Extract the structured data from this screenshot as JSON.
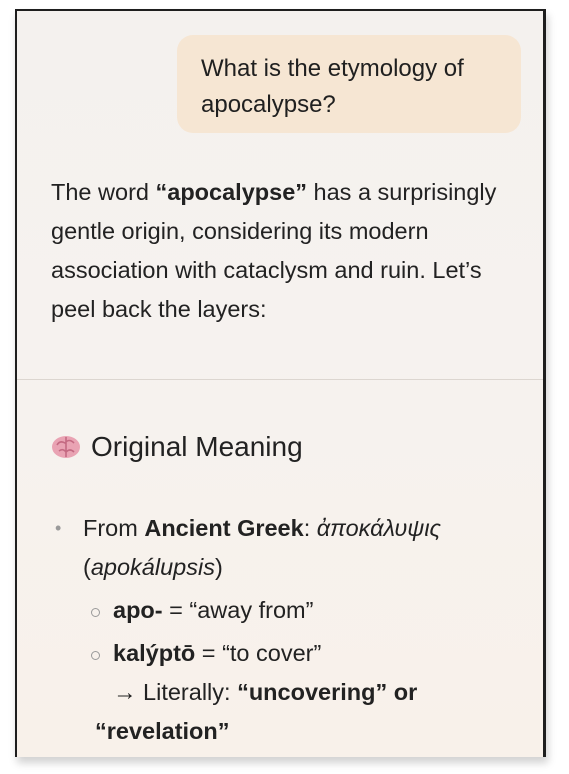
{
  "user_message": {
    "line1": "What is the etymology of",
    "line2": "apocalypse?"
  },
  "assistant": {
    "intro_before": "The word ",
    "intro_bold": "“apocalypse”",
    "intro_after": " has a surprisingly gentle origin, considering its modern association with cataclysm and ruin. Let’s peel back the layers:",
    "section_icon": "brain-icon",
    "section_title": "Original Meaning",
    "bullet_from": "From ",
    "bullet_from_bold": "Ancient Greek",
    "bullet_from_colon": ": ",
    "bullet_greek": "ἀποκάλυψις",
    "bullet_paren_open": "(",
    "bullet_translit": "apokálupsis",
    "bullet_paren_close": ")",
    "sub1_bold": "apo-",
    "sub1_rest": " = “away from”",
    "sub2_bold": "kalýptō",
    "sub2_rest": " = “to cover”",
    "literal_prefix": "→ Literally: ",
    "literal_bold1": "“uncovering” or",
    "literal_bold2": "“revelation”"
  }
}
